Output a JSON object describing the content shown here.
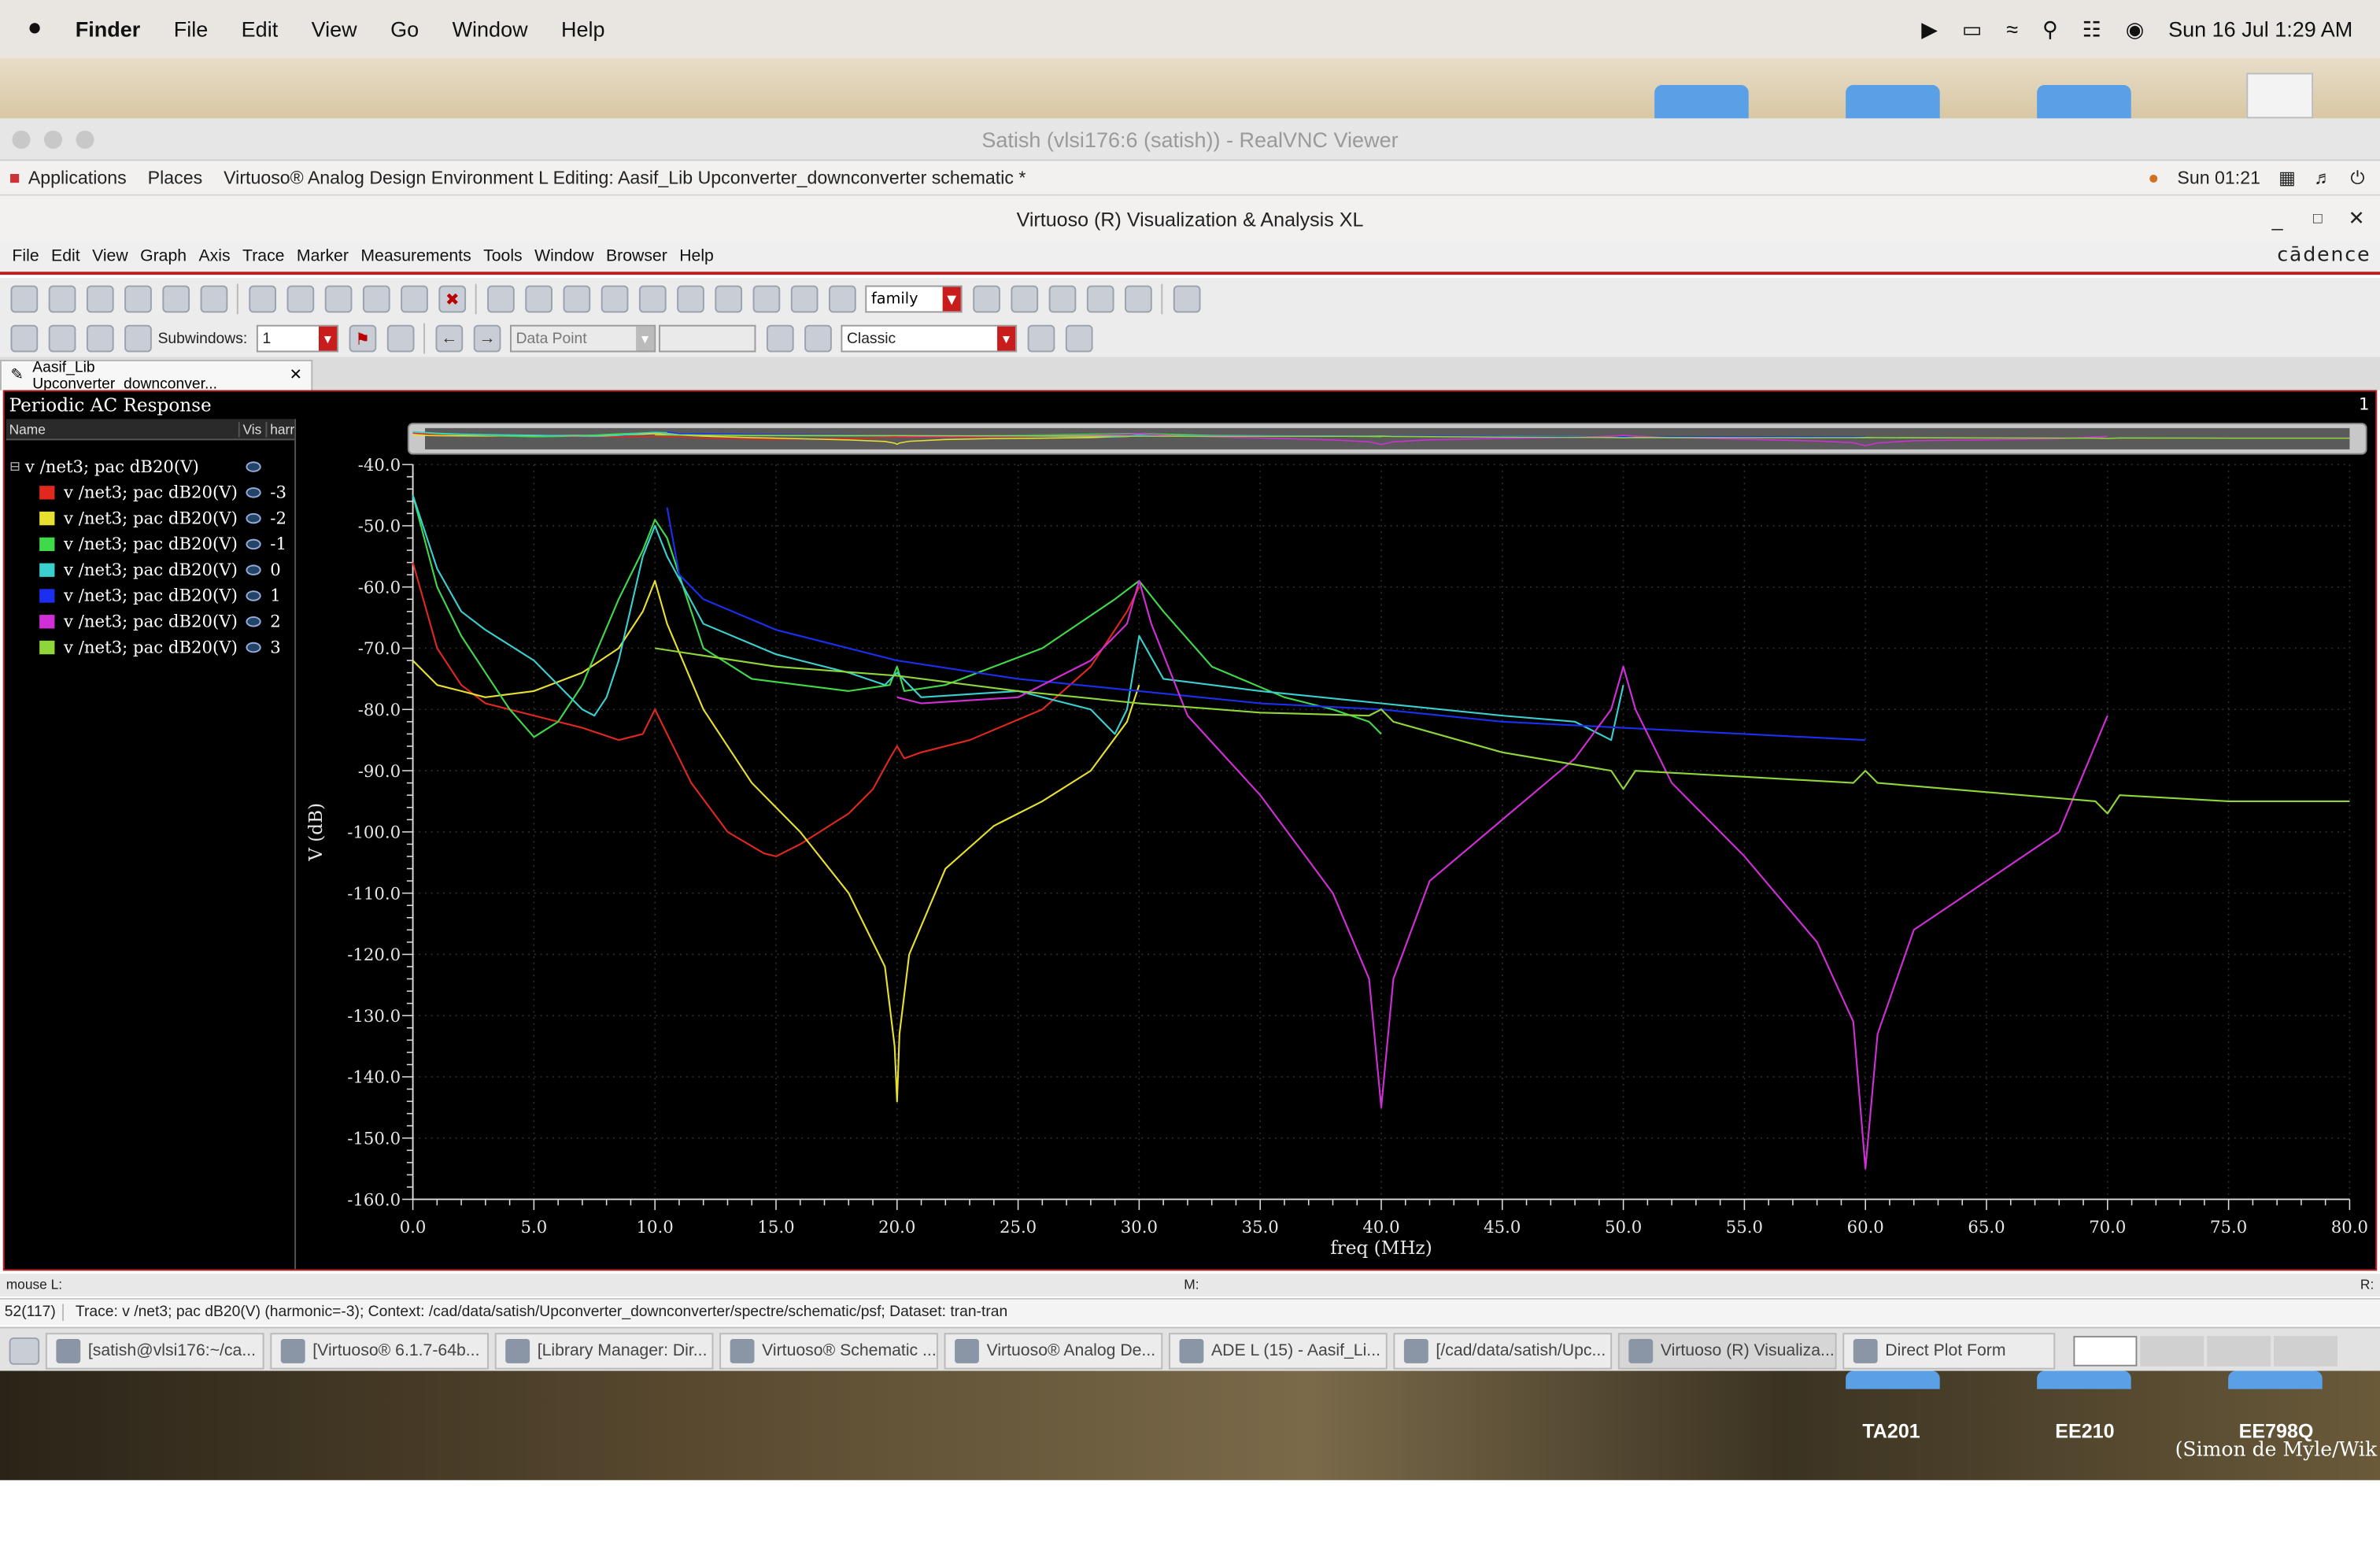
{
  "mac_menubar": {
    "apple": "",
    "app": "Finder",
    "menus": [
      "File",
      "Edit",
      "View",
      "Go",
      "Window",
      "Help"
    ],
    "clock": "Sun 16 Jul  1:29 AM"
  },
  "desktop": {
    "labels": [
      "TA201",
      "EE210",
      "EE798Q"
    ],
    "credit": "(Simon de Myle/Wik"
  },
  "vnc": {
    "title": "Satish (vlsi176:6 (satish)) - RealVNC Viewer"
  },
  "gnome_panel": {
    "applications": "Applications",
    "places": "Places",
    "window_title": "Virtuoso® Analog Design Environment L Editing: Aasif_Lib Upconverter_downconverter schematic *",
    "clock": "Sun 01:21"
  },
  "viva": {
    "title": "Virtuoso (R) Visualization & Analysis XL",
    "menus": [
      "File",
      "Edit",
      "View",
      "Graph",
      "Axis",
      "Trace",
      "Marker",
      "Measurements",
      "Tools",
      "Window",
      "Browser",
      "Help"
    ],
    "brand": "cādence",
    "toolbar": {
      "family_combo": "family",
      "subwindows_label": "Subwindows:",
      "subwindows_value": "1",
      "datapoint_combo": "Data Point",
      "style_combo": "Classic"
    },
    "tab_label": "Aasif_Lib Upconverter_downconver...",
    "plot_title": "Periodic AC Response",
    "plot_index": "1",
    "legend": {
      "col_name": "Name",
      "col_vis": "Vis",
      "col_harm": "harr",
      "group": "v /net3; pac dB20(V)",
      "rows": [
        {
          "label": "v /net3; pac dB20(V)",
          "harm": "-3",
          "color": "#e0281e"
        },
        {
          "label": "v /net3; pac dB20(V)",
          "harm": "-2",
          "color": "#e8e030"
        },
        {
          "label": "v /net3; pac dB20(V)",
          "harm": "-1",
          "color": "#3fd94a"
        },
        {
          "label": "v /net3; pac dB20(V)",
          "harm": "0",
          "color": "#3ad0d0"
        },
        {
          "label": "v /net3; pac dB20(V)",
          "harm": "1",
          "color": "#1a2ff0"
        },
        {
          "label": "v /net3; pac dB20(V)",
          "harm": "2",
          "color": "#d22ed8"
        },
        {
          "label": "v /net3; pac dB20(V)",
          "harm": "3",
          "color": "#8fd63a"
        }
      ]
    },
    "status": {
      "mouse": "mouse L:",
      "mid": "M:",
      "right": "R:"
    },
    "trace_info": {
      "count": "52(117)",
      "text": "Trace: v /net3; pac dB20(V) (harmonic=-3); Context: /cad/data/satish/Upconverter_downconverter/spectre/schematic/psf; Dataset: tran-tran"
    }
  },
  "taskbar": [
    {
      "label": "[satish@vlsi176:~/ca...",
      "active": false
    },
    {
      "label": "[Virtuoso® 6.1.7-64b...",
      "active": false
    },
    {
      "label": "[Library Manager: Dir...",
      "active": false
    },
    {
      "label": "Virtuoso® Schematic ...",
      "active": false
    },
    {
      "label": "Virtuoso® Analog De...",
      "active": false
    },
    {
      "label": "ADE L (15) - Aasif_Li...",
      "active": false
    },
    {
      "label": "[/cad/data/satish/Upc...",
      "active": false
    },
    {
      "label": "Virtuoso (R) Visualiza...",
      "active": true
    },
    {
      "label": "Direct Plot Form",
      "active": false
    }
  ],
  "chart_data": {
    "type": "line",
    "xlabel": "freq (MHz)",
    "ylabel": "V (dB)",
    "xlim": [
      0,
      80
    ],
    "ylim": [
      -160,
      -40
    ],
    "x_ticks": [
      "0.0",
      "5.0",
      "10.0",
      "15.0",
      "20.0",
      "25.0",
      "30.0",
      "35.0",
      "40.0",
      "45.0",
      "50.0",
      "55.0",
      "60.0",
      "65.0",
      "70.0",
      "75.0",
      "80.0"
    ],
    "y_ticks": [
      "-40.0",
      "-50.0",
      "-60.0",
      "-70.0",
      "-80.0",
      "-90.0",
      "-100.0",
      "-110.0",
      "-120.0",
      "-130.0",
      "-140.0",
      "-150.0",
      "-160.0"
    ],
    "grid": true,
    "series": [
      {
        "name": "v /net3; pac dB20(V) -3",
        "color": "#e0281e",
        "x": [
          0,
          1,
          2,
          3,
          5,
          7,
          8.5,
          9.5,
          10,
          10.5,
          11.5,
          13,
          14.5,
          15,
          16,
          18,
          19,
          19.7,
          20,
          20.3,
          21,
          23,
          26,
          28,
          29.5,
          30
        ],
        "y": [
          -56,
          -70,
          -76,
          -79,
          -81,
          -83,
          -85,
          -84,
          -80,
          -84,
          -92,
          -100,
          -103.5,
          -104,
          -102,
          -97,
          -93,
          -88,
          -86,
          -88,
          -87,
          -85,
          -80,
          -73,
          -64,
          -60
        ]
      },
      {
        "name": "v /net3; pac dB20(V) -2",
        "color": "#e8e030",
        "x": [
          0,
          1,
          2,
          3,
          5,
          7,
          8.5,
          9.5,
          10,
          10.5,
          12,
          14,
          16,
          18,
          19.5,
          19.9,
          20,
          20.1,
          20.5,
          22,
          24,
          26,
          28,
          29.5,
          30
        ],
        "y": [
          -72,
          -76,
          -77,
          -78,
          -77,
          -74,
          -70,
          -64,
          -59,
          -66,
          -80,
          -92,
          -100,
          -110,
          -122,
          -135,
          -144,
          -133,
          -120,
          -106,
          -99,
          -95,
          -90,
          -82,
          -76
        ]
      },
      {
        "name": "v /net3; pac dB20(V) -1",
        "color": "#3fd94a",
        "x": [
          0,
          1,
          2,
          3,
          4,
          5,
          6,
          7,
          8.5,
          9.5,
          10,
          10.5,
          12,
          14,
          16,
          18,
          19.7,
          20,
          20.3,
          22,
          26,
          29,
          30,
          31,
          33,
          36,
          38,
          39.5,
          40
        ],
        "y": [
          -45,
          -60,
          -68,
          -74,
          -80,
          -84.5,
          -82,
          -76,
          -62,
          -54,
          -49,
          -52,
          -70,
          -75,
          -76,
          -77,
          -76,
          -73,
          -77,
          -76,
          -70,
          -62,
          -59,
          -64,
          -73,
          -78,
          -80,
          -82,
          -84
        ]
      },
      {
        "name": "v /net3; pac dB20(V) 0",
        "color": "#3ad0d0",
        "x": [
          0,
          1,
          2,
          3,
          5,
          6,
          7,
          7.5,
          8,
          8.5,
          9.5,
          10,
          10.5,
          12,
          15,
          18,
          19.5,
          20,
          21,
          25,
          28,
          29,
          29.5,
          30,
          31,
          35,
          40,
          45,
          48,
          49.5,
          50
        ],
        "y": [
          -45,
          -57,
          -64,
          -67,
          -72,
          -76,
          -80,
          -81,
          -78,
          -72,
          -55,
          -50,
          -55,
          -66,
          -71,
          -74,
          -76,
          -74,
          -78,
          -77,
          -80,
          -84,
          -80,
          -68,
          -75,
          -77,
          -79,
          -81,
          -82,
          -85,
          -76
        ]
      },
      {
        "name": "v /net3; pac dB20(V) 1",
        "color": "#1a2ff0",
        "x": [
          10.5,
          11,
          12,
          15,
          20,
          25,
          30,
          35,
          40,
          45,
          50,
          55,
          60
        ],
        "y": [
          -47,
          -58,
          -62,
          -67,
          -72,
          -75,
          -77,
          -79,
          -80,
          -82,
          -83,
          -84,
          -85
        ]
      },
      {
        "name": "v /net3; pac dB20(V) 2",
        "color": "#d22ed8",
        "x": [
          20,
          21,
          25,
          28,
          29.5,
          30,
          30.5,
          32,
          35,
          38,
          39.5,
          40,
          40.5,
          42,
          45,
          48,
          49.5,
          50,
          50.5,
          52,
          55,
          58,
          59.5,
          60,
          60.5,
          62,
          65,
          68,
          70
        ],
        "y": [
          -78,
          -79,
          -78,
          -72,
          -66,
          -59,
          -66,
          -81,
          -94,
          -110,
          -124,
          -145,
          -124,
          -108,
          -98,
          -88,
          -80,
          -73,
          -80,
          -92,
          -104,
          -118,
          -131,
          -155,
          -133,
          -116,
          -108,
          -100,
          -81
        ]
      },
      {
        "name": "v /net3; pac dB20(V) 3",
        "color": "#8fd63a",
        "x": [
          10,
          15,
          20,
          25,
          30,
          35,
          39.5,
          40,
          40.5,
          45,
          49.5,
          50,
          50.5,
          55,
          59.5,
          60,
          60.5,
          65,
          69.5,
          70,
          70.5,
          75,
          80
        ],
        "y": [
          -70,
          -73,
          -74.5,
          -77,
          -79,
          -80.5,
          -81,
          -80,
          -82,
          -87,
          -90,
          -93,
          -90,
          -91,
          -92,
          -90,
          -92,
          -93.5,
          -95,
          -97,
          -94,
          -95,
          -95
        ]
      }
    ]
  }
}
